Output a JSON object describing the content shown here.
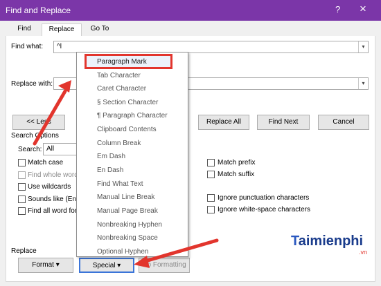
{
  "window": {
    "title": "Find and Replace",
    "help_icon": "?",
    "close_icon": "×"
  },
  "tabs": [
    {
      "label": "Find",
      "active": false
    },
    {
      "label": "Replace",
      "active": true
    },
    {
      "label": "Go To",
      "active": false
    }
  ],
  "find": {
    "label": "Find what:",
    "value": "^l"
  },
  "replace": {
    "label": "Replace with:",
    "value": ""
  },
  "buttons": {
    "less": "<< Less",
    "replace_all": "Replace All",
    "find_next": "Find Next",
    "cancel": "Cancel",
    "format": "Format ▾",
    "special": "Special ▾",
    "no_formatting": "No Formatting"
  },
  "search_options": {
    "heading": "Search Options",
    "search_label": "Search:",
    "search_value": "All",
    "left": [
      {
        "label": "Match case",
        "enabled": true
      },
      {
        "label": "Find whole words only",
        "enabled": false
      },
      {
        "label": "Use wildcards",
        "enabled": true
      },
      {
        "label": "Sounds like (English)",
        "enabled": true
      },
      {
        "label": "Find all word forms (English)",
        "enabled": true
      }
    ],
    "right": [
      {
        "label": "Match prefix",
        "enabled": true
      },
      {
        "label": "Match suffix",
        "enabled": true
      },
      {
        "label": "Ignore punctuation characters",
        "enabled": true
      },
      {
        "label": "Ignore white-space characters",
        "enabled": true
      }
    ]
  },
  "replace_section_label": "Replace",
  "special_menu": {
    "items": [
      "Paragraph Mark",
      "Tab Character",
      "Caret Character",
      "§ Section Character",
      "¶ Paragraph Character",
      "Clipboard Contents",
      "Column Break",
      "Em Dash",
      "En Dash",
      "Find What Text",
      "Manual Line Break",
      "Manual Page Break",
      "Nonbreaking Hyphen",
      "Nonbreaking Space",
      "Optional Hyphen"
    ],
    "selected_index": 0
  },
  "watermark": {
    "brand": "aimienphi",
    "brand_initial": "T",
    "suffix": ".vn"
  },
  "colors": {
    "titlebar": "#7b36a8",
    "highlight": "#e2352d",
    "arrow": "#e2352d"
  }
}
